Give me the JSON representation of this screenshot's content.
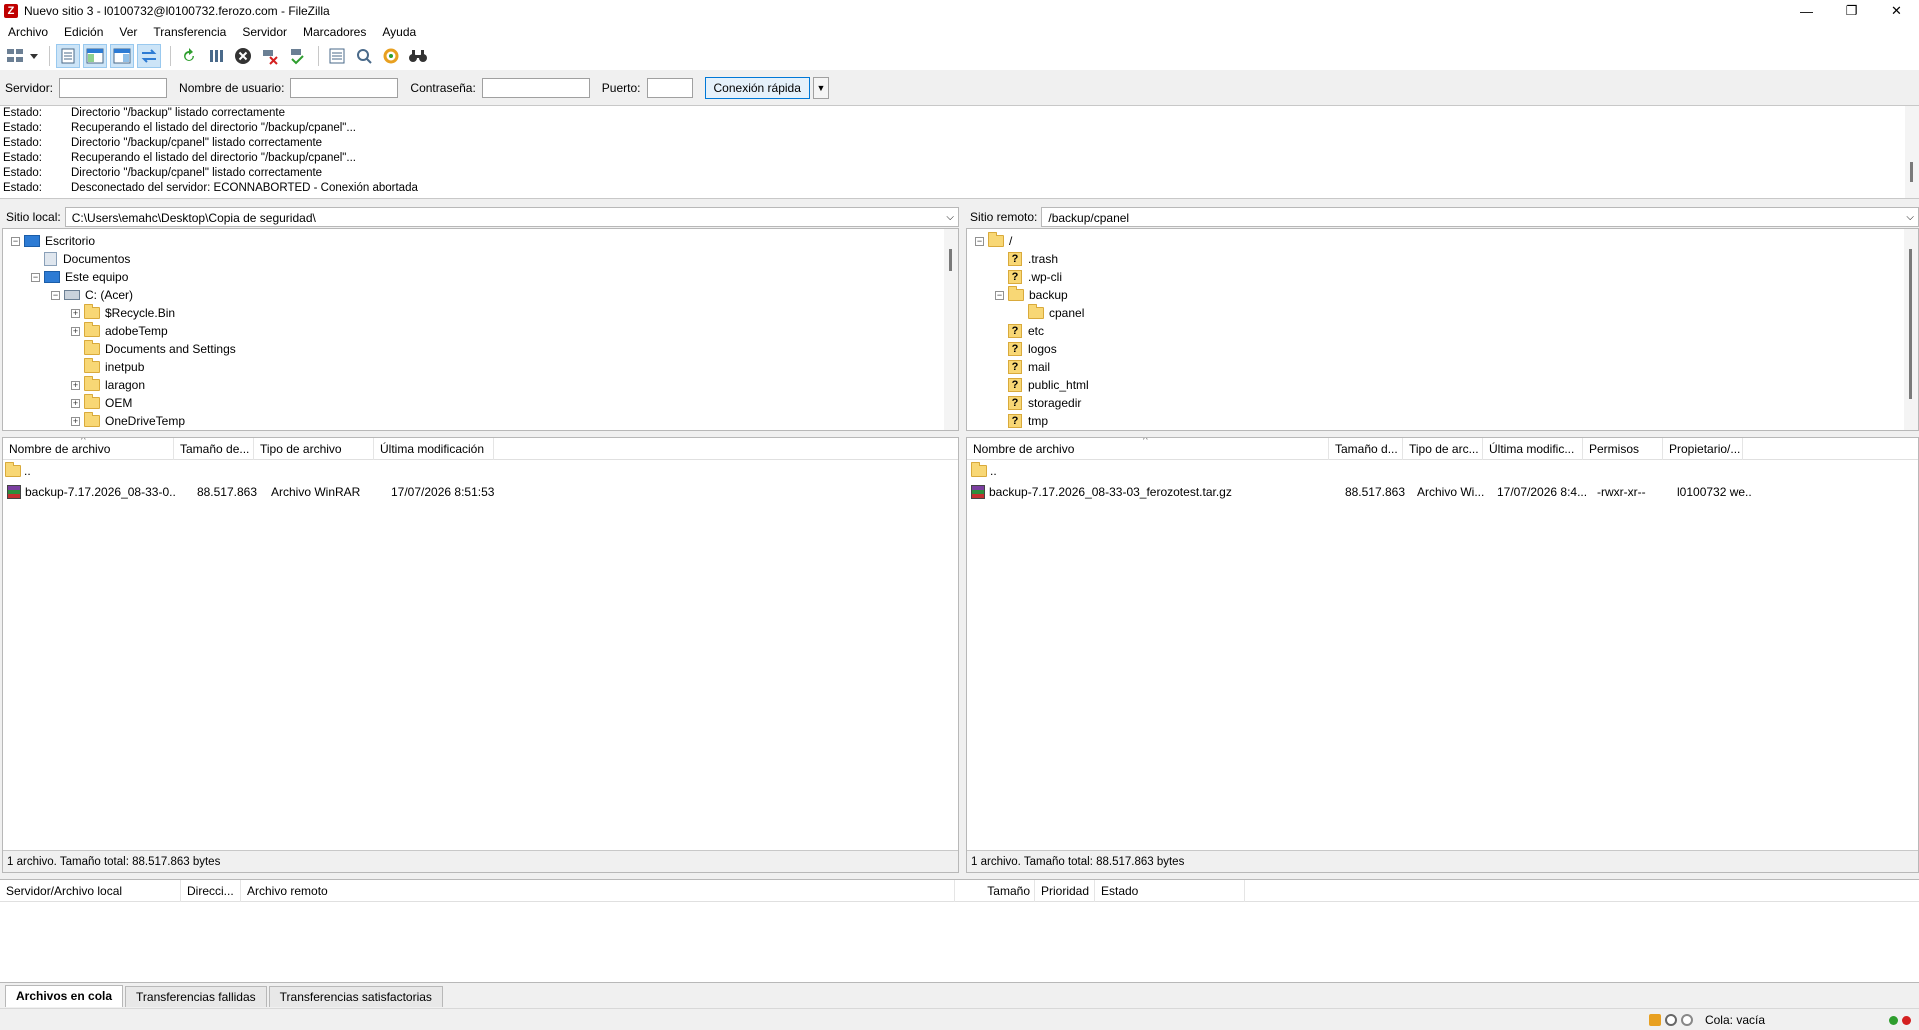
{
  "window": {
    "title": "Nuevo sitio 3 - l0100732@l0100732.ferozo.com - FileZilla",
    "app_icon": "Z",
    "minimize": "—",
    "maximize": "❐",
    "close": "✕"
  },
  "menu": [
    "Archivo",
    "Edición",
    "Ver",
    "Transferencia",
    "Servidor",
    "Marcadores",
    "Ayuda"
  ],
  "toolbar_icons": [
    "site-manager-icon",
    "toggle-log-icon",
    "toggle-local-tree-icon",
    "toggle-remote-tree-icon",
    "toggle-queue-icon",
    "refresh-icon",
    "process-queue-icon",
    "cancel-icon",
    "disconnect-icon",
    "reconnect-icon",
    "filter-icon",
    "compare-icon",
    "sync-browse-icon",
    "search-icon"
  ],
  "quickconnect": {
    "host_label": "Servidor:",
    "host_value": "",
    "user_label": "Nombre de usuario:",
    "user_value": "",
    "pass_label": "Contraseña:",
    "pass_value": "",
    "port_label": "Puerto:",
    "port_value": "",
    "button_label": "Conexión rápida",
    "dropdown_glyph": "▼"
  },
  "log": [
    {
      "label": "Estado:",
      "text": "Directorio \"/backup\" listado correctamente"
    },
    {
      "label": "Estado:",
      "text": "Recuperando el listado del directorio \"/backup/cpanel\"..."
    },
    {
      "label": "Estado:",
      "text": "Directorio \"/backup/cpanel\" listado correctamente"
    },
    {
      "label": "Estado:",
      "text": "Recuperando el listado del directorio \"/backup/cpanel\"..."
    },
    {
      "label": "Estado:",
      "text": "Directorio \"/backup/cpanel\" listado correctamente"
    },
    {
      "label": "Estado:",
      "text": "Desconectado del servidor: ECONNABORTED - Conexión abortada"
    }
  ],
  "local": {
    "site_label": "Sitio local:",
    "path": "C:\\Users\\emahc\\Desktop\\Copia de seguridad\\",
    "dropdown_glyph": "⌵",
    "tree": [
      {
        "name": "Escritorio",
        "expander": "⊟",
        "icon": "desktop"
      },
      {
        "name": "Documentos",
        "expander": "",
        "icon": "doc"
      },
      {
        "name": "Este equipo",
        "expander": "⊟",
        "icon": "desktop"
      },
      {
        "name": "C: (Acer)",
        "expander": "⊟",
        "icon": "drive"
      },
      {
        "name": "$Recycle.Bin",
        "expander": "⊞",
        "icon": "folder"
      },
      {
        "name": "adobeTemp",
        "expander": "⊞",
        "icon": "folder"
      },
      {
        "name": "Documents and Settings",
        "expander": "",
        "icon": "folder"
      },
      {
        "name": "inetpub",
        "expander": "",
        "icon": "folder"
      },
      {
        "name": "laragon",
        "expander": "⊞",
        "icon": "folder"
      },
      {
        "name": "OEM",
        "expander": "⊞",
        "icon": "folder"
      },
      {
        "name": "OneDriveTemp",
        "expander": "⊞",
        "icon": "folder"
      }
    ],
    "columns": [
      "Nombre de archivo",
      "Tamaño de...",
      "Tipo de archivo",
      "Última modificación"
    ],
    "sort_glyph": "^",
    "rows": [
      {
        "name": "..",
        "size": "",
        "type": "",
        "modified": "",
        "icon": "folder"
      },
      {
        "name": "backup-7.17.2026_08-33-0...",
        "size": "88.517.863",
        "type": "Archivo WinRAR",
        "modified": "17/07/2026 8:51:53",
        "icon": "rar"
      }
    ],
    "status": "1 archivo. Tamaño total: 88.517.863 bytes"
  },
  "remote": {
    "site_label": "Sitio remoto:",
    "path": "/backup/cpanel",
    "dropdown_glyph": "⌵",
    "tree": [
      {
        "name": "/",
        "expander": "⊟",
        "icon": "folder"
      },
      {
        "name": ".trash",
        "expander": "",
        "icon": "q"
      },
      {
        "name": ".wp-cli",
        "expander": "",
        "icon": "q"
      },
      {
        "name": "backup",
        "expander": "⊟",
        "icon": "folder"
      },
      {
        "name": "cpanel",
        "expander": "",
        "icon": "folder"
      },
      {
        "name": "etc",
        "expander": "",
        "icon": "q"
      },
      {
        "name": "logos",
        "expander": "",
        "icon": "q"
      },
      {
        "name": "mail",
        "expander": "",
        "icon": "q"
      },
      {
        "name": "public_html",
        "expander": "",
        "icon": "q"
      },
      {
        "name": "storagedir",
        "expander": "",
        "icon": "q"
      },
      {
        "name": "tmp",
        "expander": "",
        "icon": "q"
      }
    ],
    "columns": [
      "Nombre de archivo",
      "Tamaño d...",
      "Tipo de arc...",
      "Última modific...",
      "Permisos",
      "Propietario/..."
    ],
    "sort_glyph": "^",
    "rows": [
      {
        "name": "..",
        "size": "",
        "type": "",
        "modified": "",
        "perms": "",
        "owner": "",
        "icon": "folder"
      },
      {
        "name": "backup-7.17.2026_08-33-03_ferozotest.tar.gz",
        "size": "88.517.863",
        "type": "Archivo Wi...",
        "modified": "17/07/2026 8:4...",
        "perms": "-rwxr-xr--",
        "owner": "l0100732 we...",
        "icon": "rar"
      }
    ],
    "status": "1 archivo. Tamaño total: 88.517.863 bytes"
  },
  "queue": {
    "columns": [
      "Servidor/Archivo local",
      "Direcci...",
      "Archivo remoto",
      "Tamaño",
      "Prioridad",
      "Estado"
    ]
  },
  "tabs": [
    "Archivos en cola",
    "Transferencias fallidas",
    "Transferencias satisfactorias"
  ],
  "statusbar": {
    "queue_text": "Cola: vacía"
  },
  "colors": {
    "accent": "#0078d7",
    "folder": "#f8d775",
    "led_green": "#2e9e2e",
    "led_red": "#d42020"
  }
}
